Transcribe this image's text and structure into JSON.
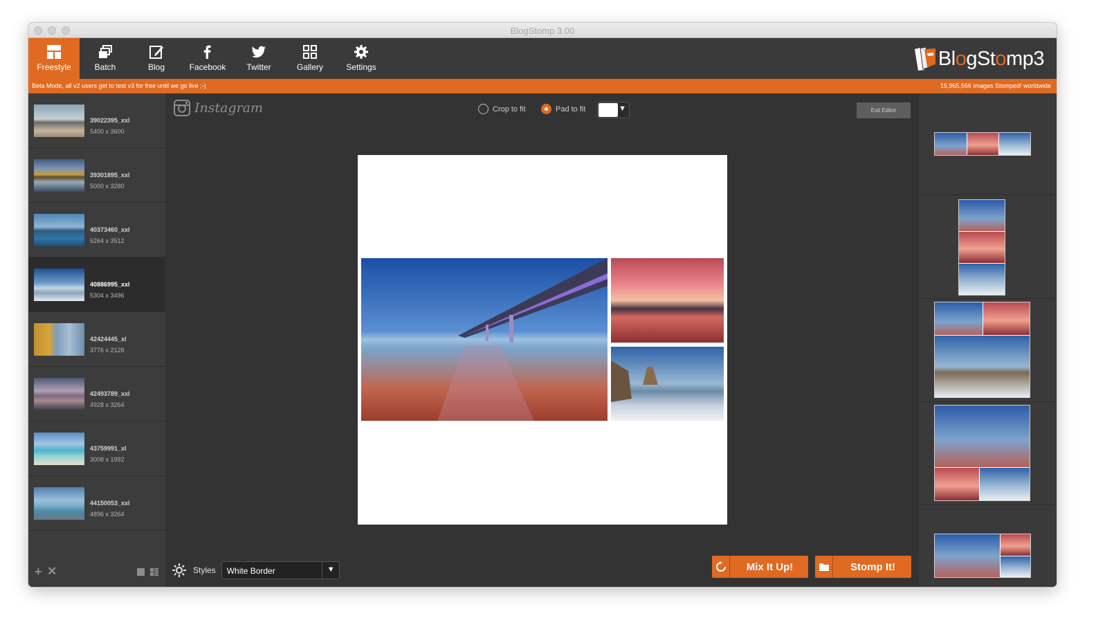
{
  "window": {
    "title": "BlogStomp 3.00"
  },
  "toolbar": {
    "items": [
      {
        "label": "Freestyle",
        "icon": "freestyle-icon",
        "active": true
      },
      {
        "label": "Batch",
        "icon": "batch-icon",
        "active": false
      },
      {
        "label": "Blog",
        "icon": "blog-icon",
        "active": false
      },
      {
        "label": "Facebook",
        "icon": "facebook-icon",
        "active": false
      },
      {
        "label": "Twitter",
        "icon": "twitter-icon",
        "active": false
      },
      {
        "label": "Gallery",
        "icon": "gallery-icon",
        "active": false
      },
      {
        "label": "Settings",
        "icon": "gear-icon",
        "active": false
      }
    ],
    "logo_text": "BlogStomp3"
  },
  "banner": {
    "left": "Beta Mode, all v2 users get to test v3 for free until we go live ;-)",
    "right": "15,965,566 images Stomped! worldwide"
  },
  "images": [
    {
      "name": "39022395_xxl",
      "dims": "5400 x 3600",
      "selected": false
    },
    {
      "name": "39301895_xxl",
      "dims": "5000 x 3280",
      "selected": false
    },
    {
      "name": "40373460_xxl",
      "dims": "5264 x 3512",
      "selected": false
    },
    {
      "name": "40886995_xxl",
      "dims": "5304 x 3496",
      "selected": true
    },
    {
      "name": "42424445_xl",
      "dims": "3776 x 2128",
      "selected": false
    },
    {
      "name": "42493789_xxl",
      "dims": "4928 x 3264",
      "selected": false
    },
    {
      "name": "43759991_xl",
      "dims": "3008 x 1992",
      "selected": false
    },
    {
      "name": "44150053_xxl",
      "dims": "4896 x 3264",
      "selected": false
    }
  ],
  "editor": {
    "platform": "Instagram",
    "crop_label": "Crop to fit",
    "pad_label": "Pad to fit",
    "fit_mode": "pad",
    "pad_color": "#ffffff",
    "exit_label": "Exit Editor",
    "styles_label": "Styles",
    "style_value": "White Border",
    "mix_label": "Mix It Up!",
    "stomp_label": "Stomp It!"
  },
  "colors": {
    "accent": "#e06a21",
    "panel": "#333333"
  }
}
